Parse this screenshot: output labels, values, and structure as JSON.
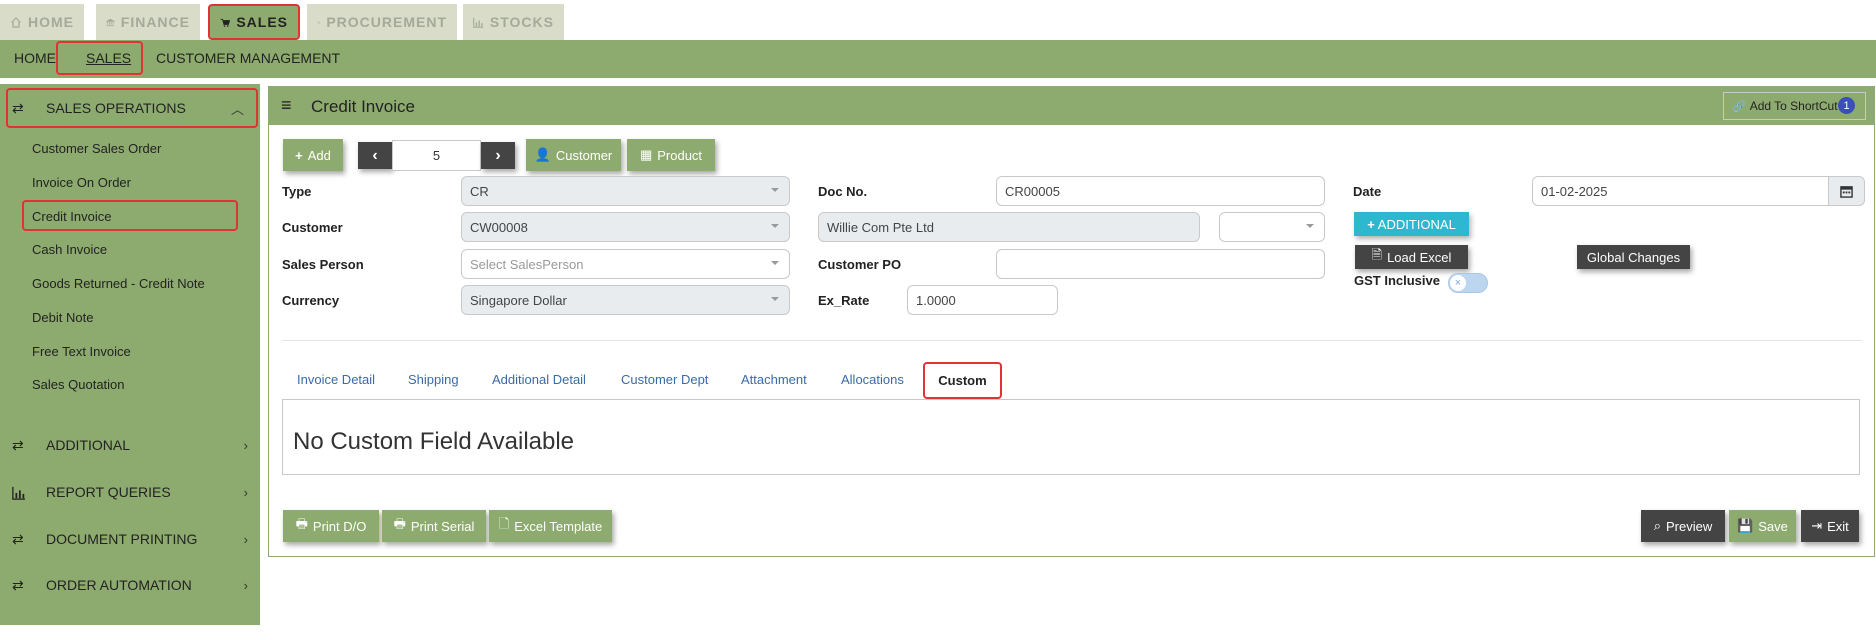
{
  "top_tabs": [
    {
      "label": "HOME",
      "icon": "home-icon"
    },
    {
      "label": "FINANCE",
      "icon": "bank-icon"
    },
    {
      "label": "SALES",
      "icon": "cart-icon"
    },
    {
      "label": "PROCUREMENT",
      "icon": "megaphone-icon"
    },
    {
      "label": "STOCKS",
      "icon": "chart-icon"
    }
  ],
  "sub_nav": [
    "HOME",
    "SALES",
    "CUSTOMER MANAGEMENT"
  ],
  "sidebar": {
    "sales_operations": "SALES OPERATIONS",
    "items": [
      "Customer Sales Order",
      "Invoice On Order",
      "Credit Invoice",
      "Cash Invoice",
      "Goods Returned - Credit Note",
      "Debit Note",
      "Free Text Invoice",
      "Sales Quotation"
    ],
    "sections": [
      "ADDITIONAL",
      "REPORT QUERIES",
      "DOCUMENT PRINTING",
      "ORDER AUTOMATION"
    ]
  },
  "panel": {
    "title": "Credit Invoice",
    "shortcut_label": "Add To ShortCut",
    "shortcut_badge": "1"
  },
  "toolbar": {
    "add": "Add",
    "record_number": "5",
    "customer": "Customer",
    "product": "Product"
  },
  "form": {
    "type_label": "Type",
    "type_value": "CR",
    "customer_label": "Customer",
    "customer_value": "CW00008",
    "sales_person_label": "Sales Person",
    "sales_person_placeholder": "Select SalesPerson",
    "currency_label": "Currency",
    "currency_value": "Singapore Dollar",
    "doc_no_label": "Doc No.",
    "doc_no_value": "CR00005",
    "customer_name": "Willie Com Pte Ltd",
    "customer_po_label": "Customer PO",
    "customer_po_value": "",
    "ex_rate_label": "Ex_Rate",
    "ex_rate_value": "1.0000",
    "date_label": "Date",
    "date_value": "01-02-2025",
    "additional_button": "ADDITIONAL",
    "load_excel": "Load Excel",
    "global_changes": "Global Changes",
    "gst_label": "GST Inclusive"
  },
  "tabs": [
    "Invoice Detail",
    "Shipping",
    "Additional Detail",
    "Customer Dept",
    "Attachment",
    "Allocations",
    "Custom"
  ],
  "custom_tab_message": "No Custom Field Available",
  "bottom_buttons": {
    "print_do": "Print D/O",
    "print_serial": "Print Serial",
    "excel_template": "Excel Template",
    "preview": "Preview",
    "save": "Save",
    "exit": "Exit"
  },
  "colors": {
    "accent": "#8eab6f",
    "highlight": "#e03434",
    "link": "#3a6aa8",
    "info": "#2db8d0"
  }
}
